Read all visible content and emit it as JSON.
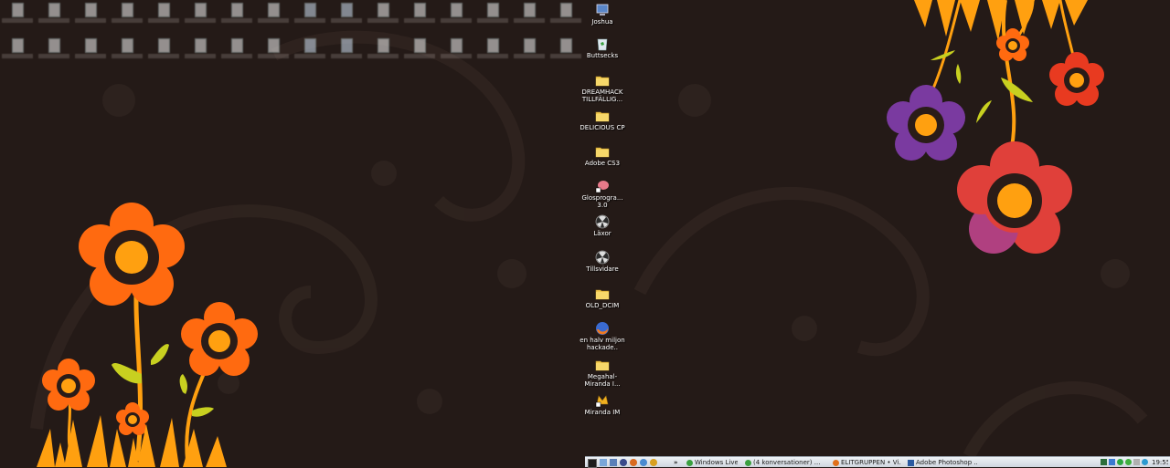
{
  "desktop": {
    "icons_right": [
      {
        "label": "Joshua",
        "icon": "computer-icon"
      },
      {
        "label": "Buttsecks",
        "icon": "recycle-bin-icon"
      },
      {
        "label": "DREAMHACK TILLFÄLLIG...",
        "icon": "folder-icon"
      },
      {
        "label": "DELICIOUS CP",
        "icon": "folder-icon"
      },
      {
        "label": "Adobe CS3",
        "icon": "folder-icon"
      },
      {
        "label": "Glosprogra... 3.0",
        "icon": "brain-shortcut-icon"
      },
      {
        "label": "Läxor",
        "icon": "radiation-icon"
      },
      {
        "label": "Tillsvidare",
        "icon": "radiation-icon"
      },
      {
        "label": "OLD_DCIM",
        "icon": "folder-icon"
      },
      {
        "label": "en halv miljon hackade..",
        "icon": "firefox-icon"
      },
      {
        "label": "Megahal-Miranda I...",
        "icon": "folder-icon"
      },
      {
        "label": "Miranda IM",
        "icon": "miranda-shortcut-icon"
      }
    ]
  },
  "taskbar": {
    "buttons": [
      {
        "label": "Windows Live Mes...",
        "icon": "messenger-icon"
      },
      {
        "label": "(4 konversationer) ...",
        "icon": "messenger-icon"
      },
      {
        "label": "ELITGRUPPEN • Vi...",
        "icon": "firefox-icon"
      },
      {
        "label": "Adobe Photoshop ...",
        "icon": "photoshop-icon"
      }
    ],
    "overflow": "»",
    "clock": "19:55"
  },
  "colors": {
    "background": "#241a17",
    "flower_orange": "#ff6a10",
    "flower_red": "#e0403a",
    "flower_purple": "#7a3aa0",
    "stem": "#ffa010",
    "leaf": "#c8d020"
  }
}
